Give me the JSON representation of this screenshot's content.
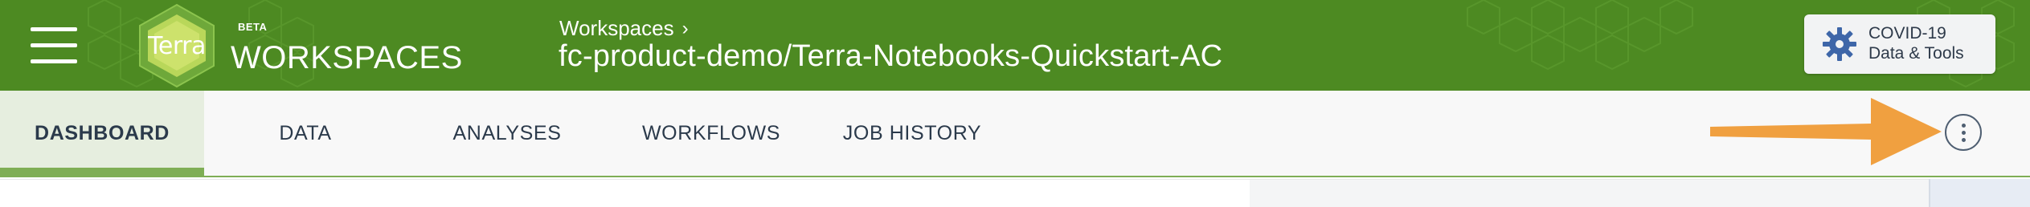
{
  "header": {
    "logo_text": "Terra",
    "beta_label": "BETA",
    "product_name": "WORKSPACES",
    "breadcrumb": {
      "parent": "Workspaces",
      "separator": "›"
    },
    "workspace_title": "fc-product-demo/Terra-Notebooks-Quickstart-AC",
    "covid_button": {
      "line1": "COVID-19",
      "line2": "Data & Tools",
      "icon": "gear-icon"
    },
    "menu_icon": "hamburger-menu-icon"
  },
  "tabs": [
    {
      "label": "DASHBOARD",
      "active": true
    },
    {
      "label": "DATA",
      "active": false
    },
    {
      "label": "ANALYSES",
      "active": false
    },
    {
      "label": "WORKFLOWS",
      "active": false
    },
    {
      "label": "JOB HISTORY",
      "active": false
    }
  ],
  "actions": {
    "more_icon": "vertical-ellipsis-icon",
    "annotation": "orange-arrow-icon"
  },
  "colors": {
    "header_green": "#4d8a22",
    "tab_accent": "#7fae55",
    "active_tab_bg": "#e6eedf",
    "arrow_orange": "#f0a040",
    "text_dark": "#2b3a4b"
  }
}
